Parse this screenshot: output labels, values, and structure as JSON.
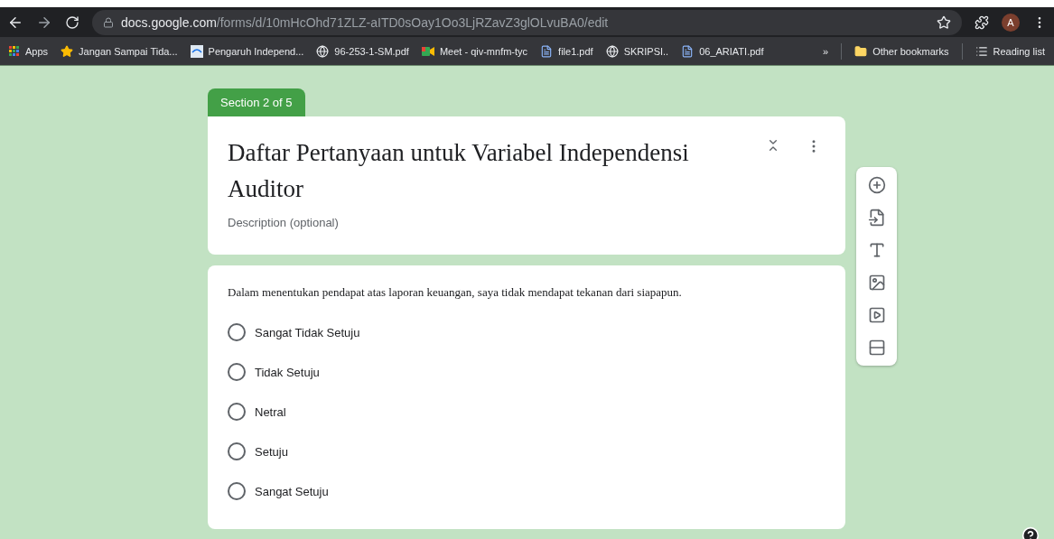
{
  "browser": {
    "url_host": "docs.google.com",
    "url_path": "/forms/d/10mHcOhd71ZLZ-aITD0sOay1Oo3LjRZavZ3glOLvuBA0/edit",
    "profile_initial": "A",
    "bookmarks": [
      {
        "label": "Apps",
        "kind": "apps"
      },
      {
        "label": "Jangan Sampai Tida...",
        "kind": "star"
      },
      {
        "label": "Pengaruh Independ...",
        "kind": "site"
      },
      {
        "label": "96-253-1-SM.pdf",
        "kind": "globe"
      },
      {
        "label": "Meet - qiv-mnfm-tyc",
        "kind": "meet"
      },
      {
        "label": "file1.pdf",
        "kind": "file"
      },
      {
        "label": "SKRIPSI..",
        "kind": "globe"
      },
      {
        "label": "06_ARIATI.pdf",
        "kind": "file"
      }
    ],
    "overflow": "»",
    "other_bookmarks": "Other bookmarks",
    "reading_list": "Reading list"
  },
  "section": {
    "badge": "Section 2 of 5",
    "title": "Daftar Pertanyaan untuk Variabel Independensi Auditor",
    "description_placeholder": "Description (optional)"
  },
  "question": {
    "text": "Dalam menentukan pendapat atas laporan keuangan, saya tidak mendapat tekanan dari siapapun.",
    "options": [
      {
        "label": "Sangat Tidak Setuju",
        "selected": false
      },
      {
        "label": "Tidak Setuju",
        "selected": false
      },
      {
        "label": "Netral",
        "selected": false
      },
      {
        "label": "Setuju",
        "selected": false
      },
      {
        "label": "Sangat Setuju",
        "selected": false
      }
    ]
  }
}
